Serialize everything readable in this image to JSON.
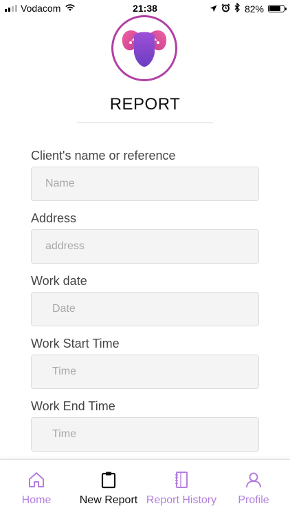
{
  "status_bar": {
    "carrier": "Vodacom",
    "time": "21:38",
    "battery_percent": "82%",
    "battery_level": 0.82
  },
  "page": {
    "title": "REPORT"
  },
  "form": {
    "fields": [
      {
        "label": "Client's name or reference",
        "placeholder": "Name"
      },
      {
        "label": "Address",
        "placeholder": "address"
      },
      {
        "label": "Work date",
        "placeholder": "Date"
      },
      {
        "label": "Work Start Time",
        "placeholder": "Time"
      },
      {
        "label": "Work End Time",
        "placeholder": "Time"
      }
    ]
  },
  "tab_bar": {
    "items": [
      {
        "label": "Home",
        "icon": "home-icon",
        "active": false
      },
      {
        "label": "New Report",
        "icon": "clipboard-icon",
        "active": true
      },
      {
        "label": "Report History",
        "icon": "notebook-icon",
        "active": false
      },
      {
        "label": "Profile",
        "icon": "user-icon",
        "active": false
      }
    ]
  },
  "colors": {
    "accent": "#b47fe0",
    "active_tab": "#111111",
    "logo_ring": "#b13fa5",
    "input_bg": "#f4f4f4"
  }
}
